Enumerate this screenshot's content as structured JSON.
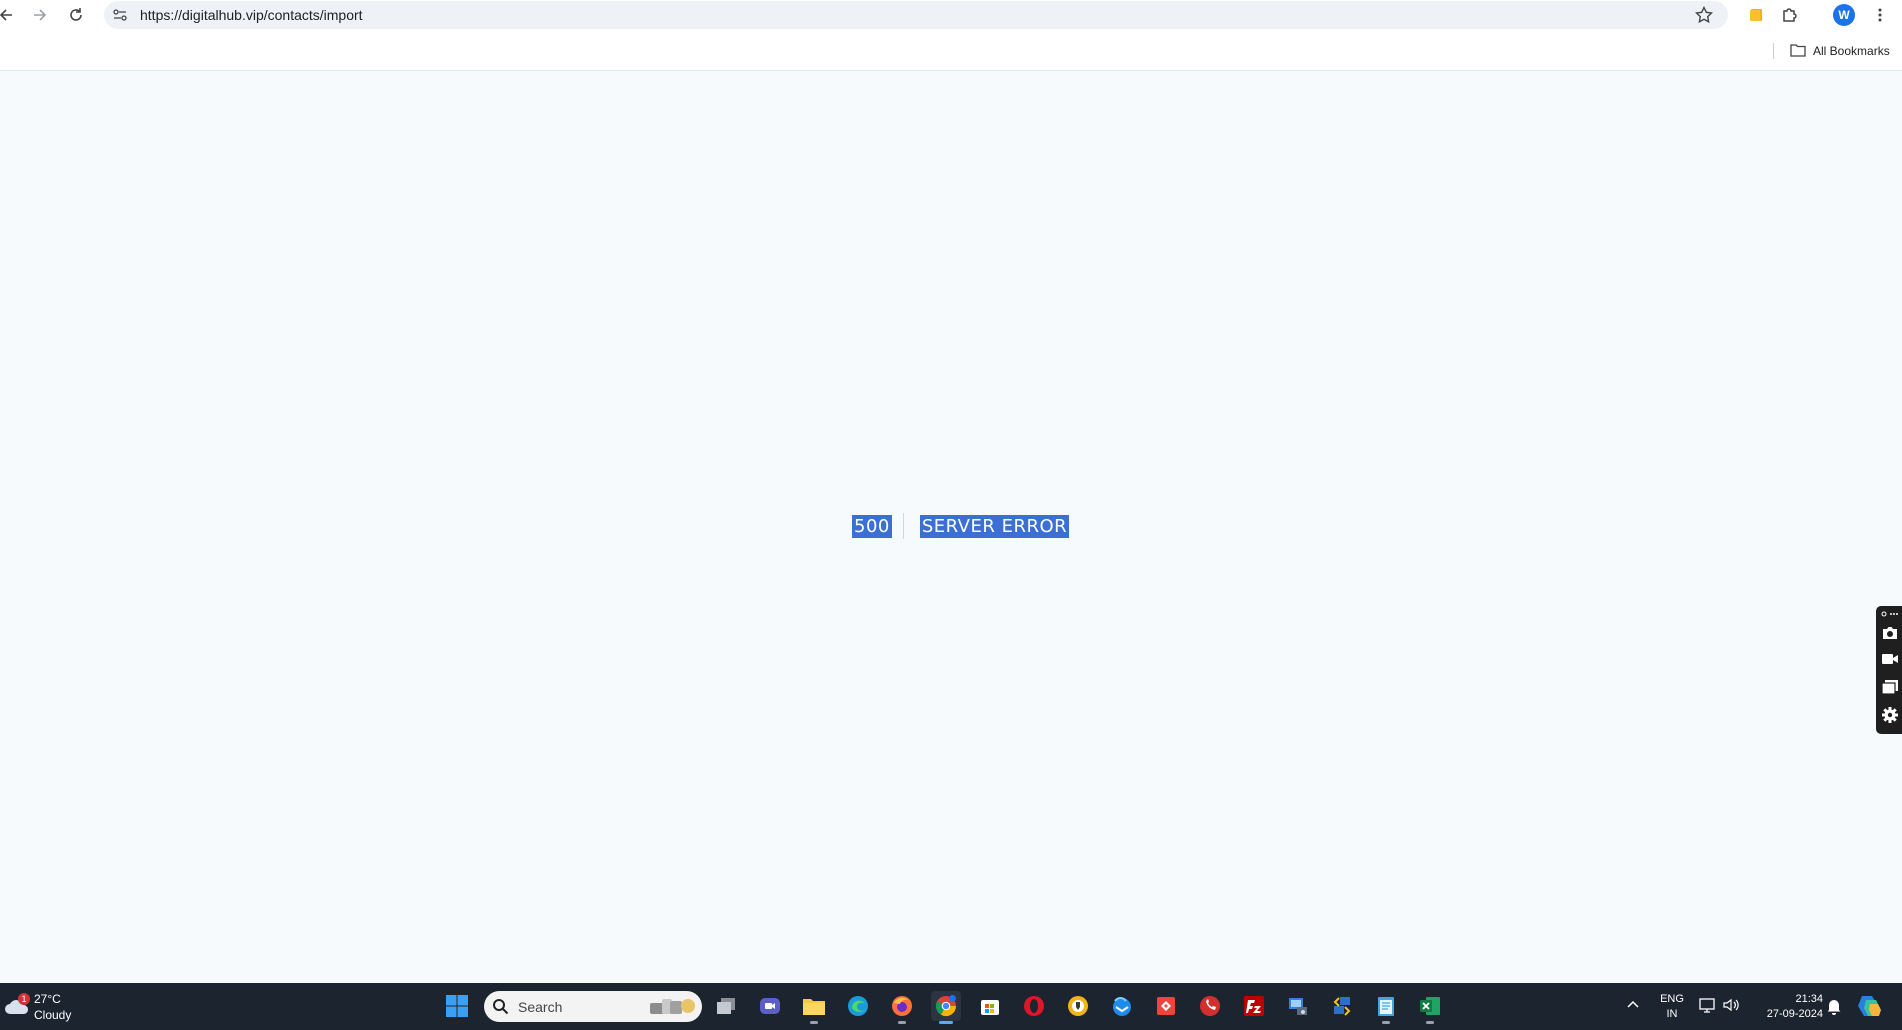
{
  "browser": {
    "url": "https://digitalhub.vip/contacts/import",
    "profile_initial": "W",
    "bookmarks_label": "All Bookmarks"
  },
  "page": {
    "error_code": "500",
    "error_message": "SERVER ERROR"
  },
  "taskbar": {
    "weather": {
      "temp": "27°C",
      "condition": "Cloudy",
      "badge": "1"
    },
    "search_placeholder": "Search",
    "language_line1": "ENG",
    "language_line2": "IN",
    "time": "21:34",
    "date": "27-09-2024"
  },
  "colors": {
    "selection": "#3b6fd4",
    "page_bg": "#f7fafc",
    "taskbar_bg": "#1c2430"
  }
}
